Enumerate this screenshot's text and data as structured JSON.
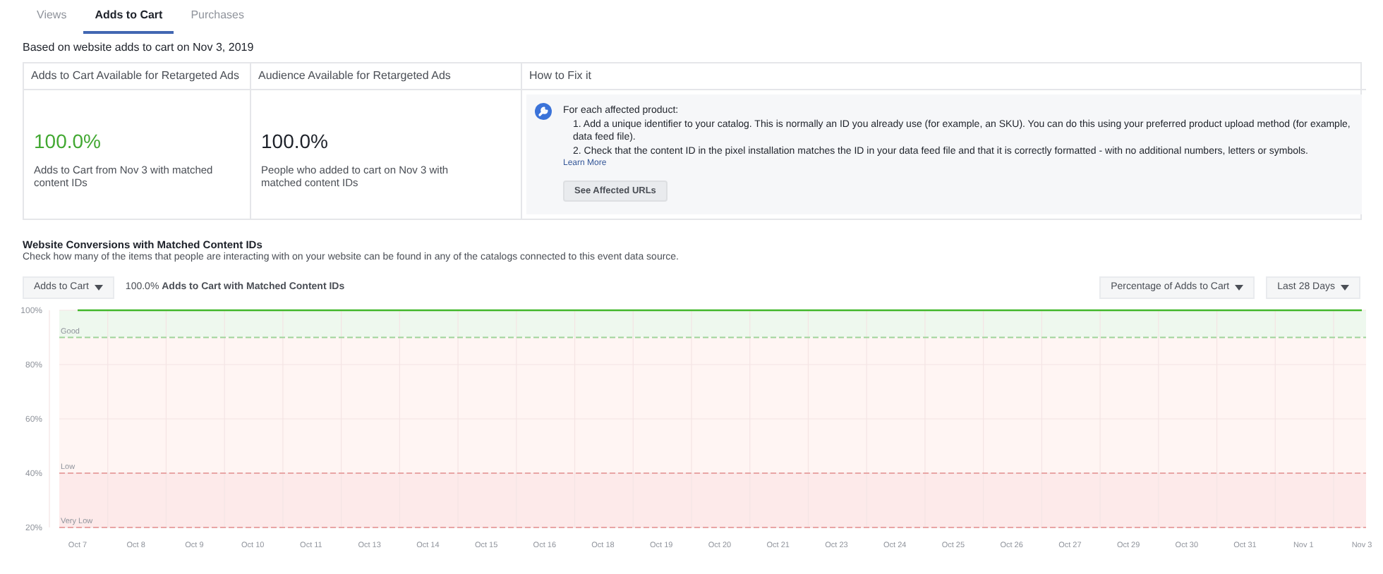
{
  "tabs": [
    {
      "label": "Views",
      "selected": false
    },
    {
      "label": "Adds to Cart",
      "selected": true
    },
    {
      "label": "Purchases",
      "selected": false
    }
  ],
  "subtitle": "Based on website adds to cart on Nov 3, 2019",
  "summary": {
    "columns": [
      "Adds to Cart Available for Retargeted Ads",
      "Audience Available for Retargeted Ads",
      "How to Fix it"
    ],
    "stats": [
      {
        "value": "100.0%",
        "caption": "Adds to Cart from Nov 3 with matched content IDs",
        "color": "#42a832"
      },
      {
        "value": "100.0%",
        "caption": "People who added to cart on Nov 3 with matched content IDs",
        "color": "#1d2129"
      }
    ],
    "fix": {
      "intro": "For each affected product:",
      "steps": [
        "1. Add a unique identifier to your catalog. This is normally an ID you already use (for example, an SKU). You can do this using your preferred product upload method (for example, data feed file).",
        "2. Check that the content ID in the pixel installation matches the ID in your data feed file and that it is correctly formatted - with no additional numbers, letters or symbols."
      ],
      "link": "Learn More",
      "button": "See Affected URLs"
    }
  },
  "section": {
    "title": "Website Conversions with Matched Content IDs",
    "description": "Check how many of the items that people are interacting with on your website can be found in any of the catalogs connected to this event data source.",
    "event_dropdown": "Adds to Cart",
    "summary": "100.0% **Adds to Cart with Matched Content IDs**",
    "metric_dropdown": "Percentage of Adds to Cart",
    "range_dropdown": "Last 28 Days",
    "chart_data": {
      "type": "line",
      "categories": [
        "Oct 7",
        "Oct 8",
        "Oct 9",
        "Oct 10",
        "Oct 11",
        "Oct 13",
        "Oct 14",
        "Oct 15",
        "Oct 16",
        "Oct 18",
        "Oct 19",
        "Oct 20",
        "Oct 21",
        "Oct 23",
        "Oct 24",
        "Oct 25",
        "Oct 26",
        "Oct 27",
        "Oct 29",
        "Oct 30",
        "Oct 31",
        "Nov 1",
        "Nov 3"
      ],
      "series": [
        {
          "color": "#42b72a",
          "values": [
            100,
            100,
            100,
            100,
            100,
            100,
            100,
            100,
            100,
            100,
            100,
            100,
            100,
            100,
            100,
            100,
            100,
            100,
            100,
            100,
            100,
            100,
            100
          ]
        }
      ],
      "ylim": [
        20,
        100
      ],
      "yticks": [
        {
          "value": 20,
          "label": "20%"
        },
        {
          "value": 40,
          "label": "40%"
        },
        {
          "value": 60,
          "label": "60%"
        },
        {
          "value": 80,
          "label": "80%"
        },
        {
          "value": 100,
          "label": "100%"
        }
      ],
      "grid": true,
      "bands": [
        {
          "axis": "y",
          "from": 90,
          "to": 100,
          "color": "#eef8ee"
        },
        {
          "axis": "y",
          "from": 40,
          "to": 90,
          "color": "#fff5f3"
        },
        {
          "axis": "y",
          "from": 20,
          "to": 40,
          "color": "#fdeaea"
        }
      ],
      "ref_lines": [
        {
          "axis": "y",
          "value": 90,
          "label": "Good",
          "color": "#9fd49a"
        },
        {
          "axis": "y",
          "value": 40,
          "label": "Low",
          "color": "#e8a5a5"
        },
        {
          "axis": "y",
          "value": 20,
          "label": "Very Low",
          "color": "#e8a5a5"
        }
      ]
    }
  }
}
